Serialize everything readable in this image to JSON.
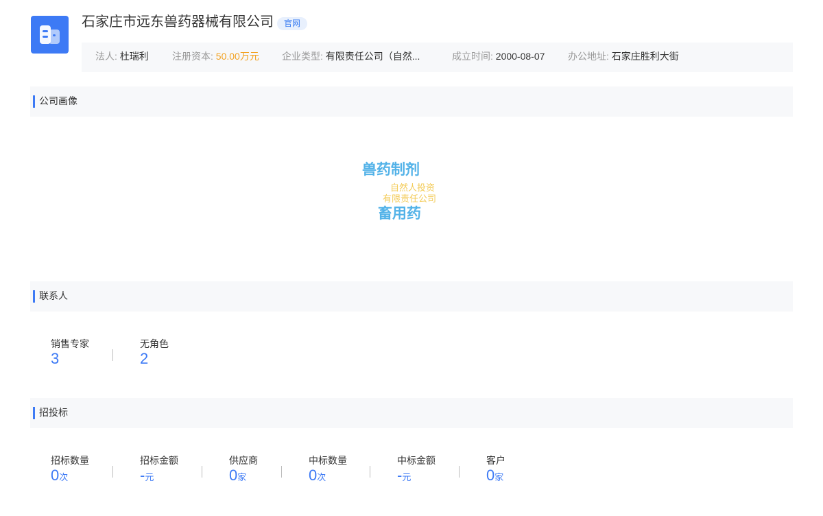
{
  "company": {
    "name": "石家庄市远东兽药器械有限公司",
    "badge": "官网"
  },
  "info": {
    "legal_rep_label": "法人:",
    "legal_rep": "杜瑞利",
    "capital_label": "注册资本:",
    "capital": "50.00万元",
    "type_label": "企业类型:",
    "type": "有限责任公司（自然...",
    "founded_label": "成立时间:",
    "founded": "2000-08-07",
    "address_label": "办公地址:",
    "address": "石家庄胜利大街"
  },
  "sections": {
    "portrait": "公司画像",
    "contacts": "联系人",
    "bidding": "招投标"
  },
  "tags": [
    "兽药制剂",
    "自然人投资",
    "有限责任公司",
    "畜用药"
  ],
  "contacts": [
    {
      "label": "销售专家",
      "value": "3"
    },
    {
      "label": "无角色",
      "value": "2"
    }
  ],
  "bidding": [
    {
      "label": "招标数量",
      "value": "0",
      "unit": "次"
    },
    {
      "label": "招标金额",
      "value": "-",
      "unit": "元"
    },
    {
      "label": "供应商",
      "value": "0",
      "unit": "家"
    },
    {
      "label": "中标数量",
      "value": "0",
      "unit": "次"
    },
    {
      "label": "中标金额",
      "value": "-",
      "unit": "元"
    },
    {
      "label": "客户",
      "value": "0",
      "unit": "家"
    }
  ],
  "colors": {
    "accent": "#3d7af5",
    "money": "#f2a222",
    "tag_primary": "#52b2e8",
    "tag_secondary": "#f3cb57"
  }
}
